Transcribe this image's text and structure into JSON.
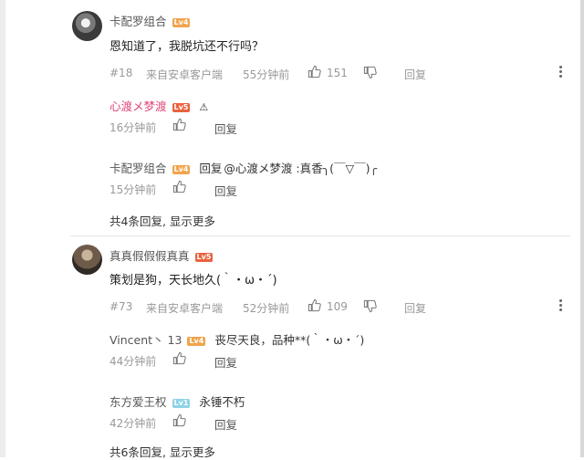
{
  "comments": [
    {
      "username": "卡配罗组合",
      "level": "Lv4",
      "text": "恩知道了，我脱坑还不行吗？",
      "floor": "#18",
      "source": "来自安卓客户端",
      "time": "55分钟前",
      "likes": "151",
      "reply_label": "回复",
      "replies": [
        {
          "username": "心渡メ梦渡",
          "level": "Lv5",
          "text": "⚠",
          "time": "16分钟前",
          "reply_label": "回复"
        },
        {
          "username": "卡配罗组合",
          "level": "Lv4",
          "reply_prefix": "回复",
          "text": "@心渡メ梦渡 :真香╮(￣▽￣)╭",
          "time": "15分钟前",
          "reply_label": "回复"
        }
      ],
      "show_more": "共4条回复, 显示更多"
    },
    {
      "username": "真真假假假真真",
      "level": "Lv5",
      "text": "策划是狗，天长地久(｀・ω・´)",
      "floor": "#73",
      "source": "来自安卓客户端",
      "time": "52分钟前",
      "likes": "109",
      "reply_label": "回复",
      "replies": [
        {
          "username": "Vincent丶 13",
          "level": "Lv4",
          "text": "丧尽天良，品种**(｀・ω・´)",
          "time": "44分钟前",
          "reply_label": "回复"
        },
        {
          "username": "东方爱王权",
          "level": "Lv1",
          "text": "永锤不朽",
          "time": "42分钟前",
          "reply_label": "回复"
        }
      ],
      "show_more": "共6条回复, 显示更多"
    }
  ],
  "icons": {
    "like": "thumbs-up-icon",
    "dislike": "thumbs-down-icon",
    "more": "more-vertical-icon"
  },
  "colors": {
    "pink_name": "#e0467a",
    "lv_orange": "#f0a44c",
    "lv_red": "#e9623f",
    "lv_blue": "#8fd3e6"
  }
}
